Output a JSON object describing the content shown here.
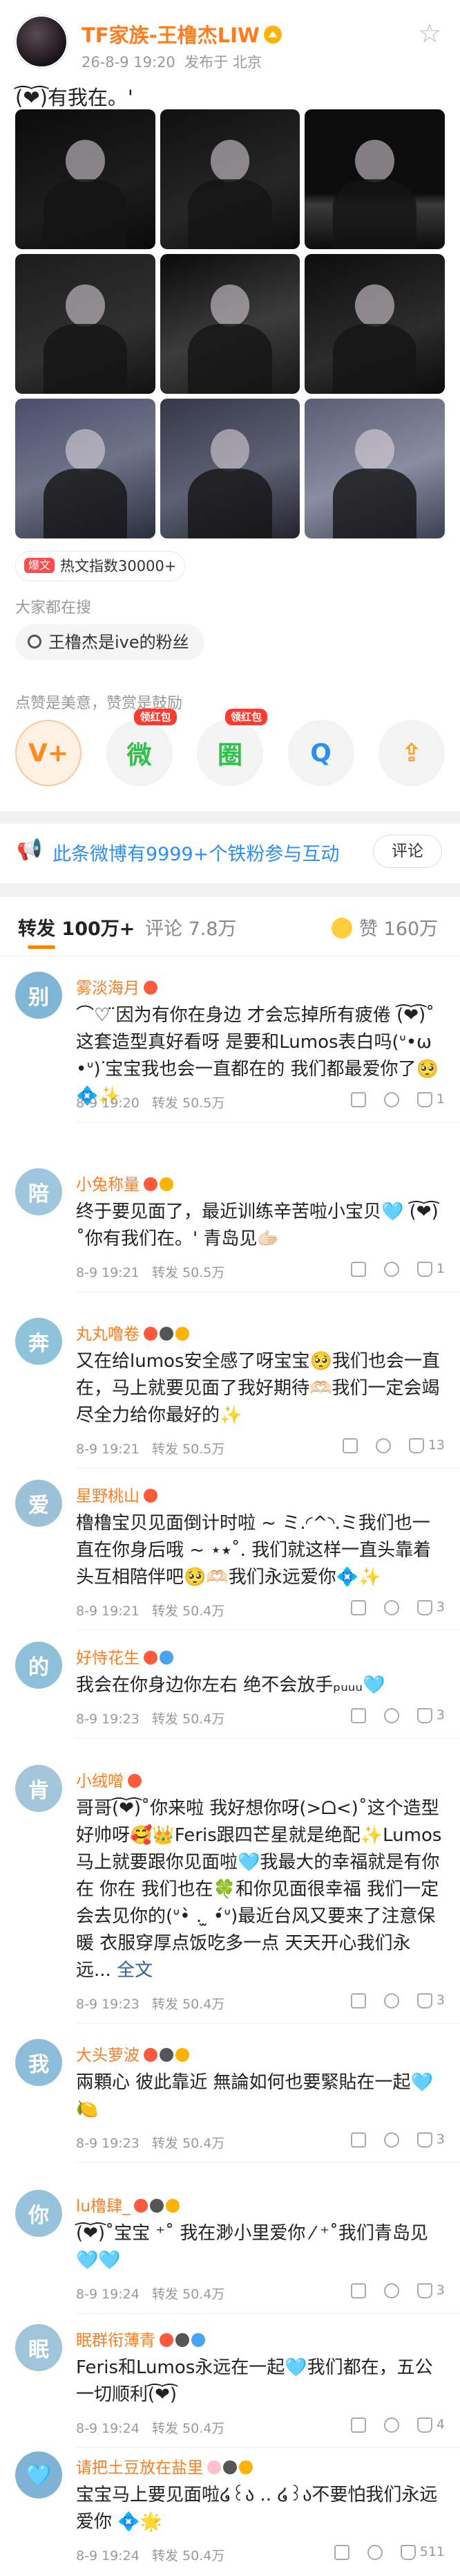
{
  "post": {
    "author": "TF家族-王橹杰LIW",
    "time": "26-8-9 19:20",
    "location": "发布于 北京",
    "text": "(͡❤︎͡)有我在。'",
    "hot_tag": "爆文",
    "hot_text": "热文指数30000+",
    "search_title": "大家都在搜",
    "search_query": "王橹杰是ive的粉丝",
    "share_title": "点赞是美意，赞赏是鼓励",
    "share": [
      {
        "label": "V+",
        "icon": "vplus-icon"
      },
      {
        "label": "微",
        "icon": "wechat-icon",
        "badge": "领红包"
      },
      {
        "label": "圈",
        "icon": "moments-icon",
        "badge": "领红包"
      },
      {
        "label": "Q",
        "icon": "qq-icon"
      },
      {
        "label": "⇪",
        "icon": "save-icon"
      }
    ],
    "fans_text": "此条微博有9999+个铁粉参与互动",
    "fans_button": "评论"
  },
  "tabs": {
    "forward_label": "转发",
    "forward_count": "100万+",
    "comment_label": "评论",
    "comment_count": "7.8万",
    "like_label": "赞",
    "like_count": "160万"
  },
  "forward_action": "转发",
  "comments": [
    {
      "avatar": "别",
      "color": "#7fb6d6",
      "name": "雾淡海月",
      "badges": [
        "#ff5a3c"
      ],
      "text": "⌒♡ ̈因为有你在身边 才会忘掉所有疲倦 (͡❤︎͡)˚这套造型真好看呀 是要和Lumos表白吗(ᐡ•ω•ᐡ)ᐝ宝宝我也会一直都在的 我们都最爱你了🥺💠✨",
      "time": "8-9 19:20",
      "forward": "50.5万",
      "likes": "1"
    },
    {
      "avatar": "陪",
      "color": "#9ec7de",
      "name": "小兔称量",
      "badges": [
        "#ff5a3c",
        "#ffb300"
      ],
      "text": "终于要见面了，最近训练辛苦啦小宝贝🩵 (͡❤︎͡)˚你有我们在。' 青岛见🫱🏻",
      "time": "8-9 19:21",
      "forward": "50.5万",
      "likes": "1"
    },
    {
      "avatar": "奔",
      "color": "#8ec3d9",
      "name": "丸丸噜卷",
      "badges": [
        "#ff5a3c",
        "#555",
        "#ffb300"
      ],
      "text": "又在给lumos安全感了呀宝宝🥺我们也会一直在，马上就要见面了我好期待🫶🏻我们一定会竭尽全力给你最好的✨",
      "time": "8-9 19:21",
      "forward": "50.5万",
      "likes": "13"
    },
    {
      "avatar": "爱",
      "color": "#9bc2d8",
      "name": "星野桃山",
      "badges": [
        "#ff5a3c"
      ],
      "text": "橹橹宝贝见面倒计时啦 ~ ミ.◜^◝.ミ我们也一直在你身后哦 ~ ⋆⭑˚. 我们就这样一直头靠着头互相陪伴吧🥺🫶🏻我们永远爱你💠✨",
      "time": "8-9 19:21",
      "forward": "50.4万",
      "likes": "3"
    },
    {
      "avatar": "的",
      "color": "#8fc0da",
      "name": "好恃花生",
      "badges": [
        "#ff5a3c",
        "#4aa3f0"
      ],
      "text": "我会在你身边你左右 绝不会放手ₚᵤᵤᵤ🩵",
      "time": "8-9 19:23",
      "forward": "50.4万",
      "likes": "3"
    },
    {
      "avatar": "肯",
      "color": "#a3c6db",
      "name": "小绒噌",
      "badges": [
        "#ff5a3c"
      ],
      "text": "哥哥(͡❤︎͡)˚你来啦 我好想你呀(>ᗝ<)˚这个造型好帅呀🥰👑Feris跟四芒星就是绝配✨Lumos马上就要跟你见面啦🩵我最大的幸福就是有你在 你在 我们也在🍀和你见面很幸福 我们一定会去见你的(ᐡ•̀ . ̫ •́ᐡ)最近台风又要来了注意保暖 衣服穿厚点饭吃多一点 天天开心我们永远...",
      "more": "全文",
      "time": "8-9 19:23",
      "forward": "50.4万",
      "likes": "3"
    },
    {
      "avatar": "我",
      "color": "#8dbdd8",
      "name": "大头萝波",
      "badges": [
        "#ff5a3c",
        "#555",
        "#ffb300"
      ],
      "text": "兩顆心 彼此靠近 無論如何也要緊貼在一起🩵🍋",
      "time": "8-9 19:23",
      "forward": "50.4万",
      "likes": "3"
    },
    {
      "avatar": "你",
      "color": "#97c3dc",
      "name": "lu橹肆_",
      "badges": [
        "#ff5a3c",
        "#555",
        "#ffb300"
      ],
      "text": "(͡❤︎͡)˚宝宝 ⁺˚ 我在渺小里爱你 ⁄ ⁺˚我们青岛见🩵🩵",
      "time": "8-9 19:24",
      "forward": "50.4万",
      "likes": "3"
    },
    {
      "avatar": "眠",
      "color": "#a0c4d9",
      "name": "眠群衔薄青",
      "badges": [
        "#ff5a3c",
        "#555",
        "#4aa3f0"
      ],
      "text": "Feris和Lumos永远在一起🩵我们都在，五公一切顺利(͡❤︎͡)",
      "time": "8-9 19:24",
      "forward": "50.4万",
      "likes": "4"
    },
    {
      "avatar": "🩵",
      "color": "#7fb2d4",
      "name": "请把土豆放在盐里",
      "badges": [
        "#ffc0d0",
        "#555",
        "#ffb300"
      ],
      "text": "宝宝马上要见面啦໒꒰ა .. ໒꒱ა不要怕我们永远爱你 💠🌟",
      "time": "8-9 19:24",
      "forward": "50.4万",
      "likes": "511"
    }
  ]
}
